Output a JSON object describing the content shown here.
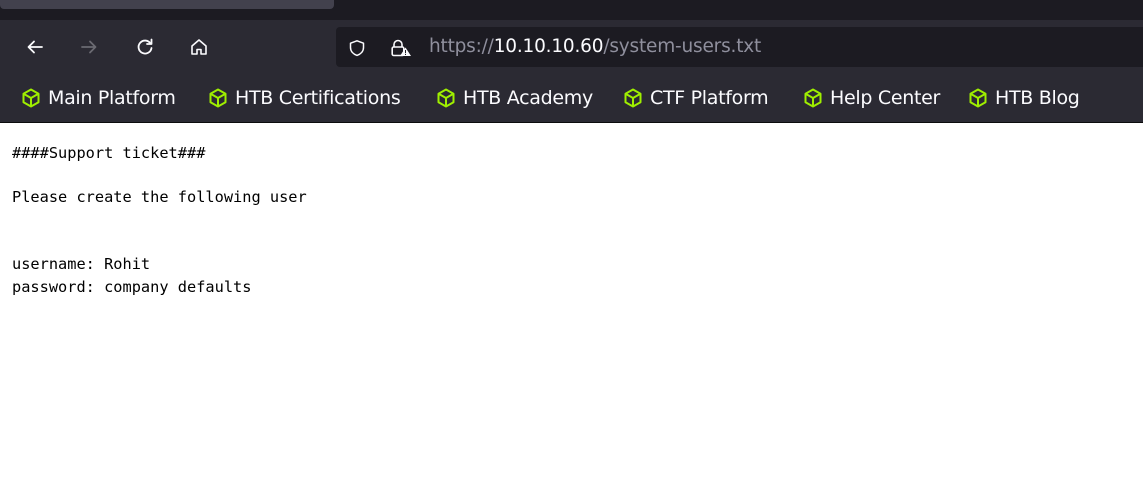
{
  "browser": {
    "url": {
      "scheme": "https://",
      "host": "10.10.10.60",
      "path": "/system-users.txt"
    },
    "nav_icons": [
      "back-arrow-icon",
      "forward-arrow-icon",
      "reload-icon",
      "home-icon"
    ],
    "url_icons": [
      "shield-icon",
      "insecure-lock-icon"
    ]
  },
  "bookmarks": [
    {
      "label": "Main Platform",
      "icon": "cube-icon"
    },
    {
      "label": "HTB Certifications",
      "icon": "cube-icon"
    },
    {
      "label": "HTB Academy",
      "icon": "cube-icon"
    },
    {
      "label": "CTF Platform",
      "icon": "cube-icon"
    },
    {
      "label": "Help Center",
      "icon": "cube-icon"
    },
    {
      "label": "HTB Blog",
      "icon": "cube-icon"
    }
  ],
  "document": {
    "heading": "####Support ticket###",
    "request": "Please create the following user",
    "username_line": "username: Rohit",
    "password_line": "password: company defaults"
  },
  "colors": {
    "chrome_dark": "#1c1b22",
    "toolbar": "#2b2a33",
    "accent_green": "#9fef00",
    "url_dim": "#8f8f9d",
    "url_host": "#fbfbfe"
  }
}
